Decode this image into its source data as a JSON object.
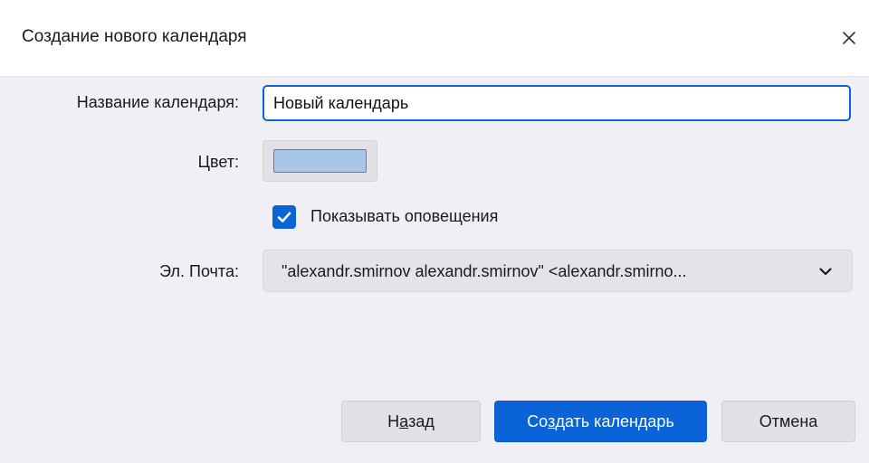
{
  "dialog": {
    "title": "Создание нового календаря"
  },
  "form": {
    "name_label": "Название календаря:",
    "name_value": "Новый календарь",
    "color_label": "Цвет:",
    "color_value": "#a8c6e8",
    "notifications_label": "Показывать оповещения",
    "notifications_checked": true,
    "email_label": "Эл. Почта:",
    "email_value": "\"alexandr.smirnov alexandr.smirnov\" <alexandr.smirno..."
  },
  "buttons": {
    "back": {
      "pre": "Н",
      "key": "а",
      "post": "зад"
    },
    "create": {
      "pre": "Со",
      "key": "з",
      "post": "дать календарь"
    },
    "cancel": "Отмена"
  },
  "icons": {
    "close": "close-icon",
    "checkmark": "checkmark-icon",
    "chevron": "chevron-down-icon"
  },
  "colors": {
    "accent": "#0a64d8",
    "background": "#f0f0f4",
    "swatch": "#a8c6e8"
  }
}
